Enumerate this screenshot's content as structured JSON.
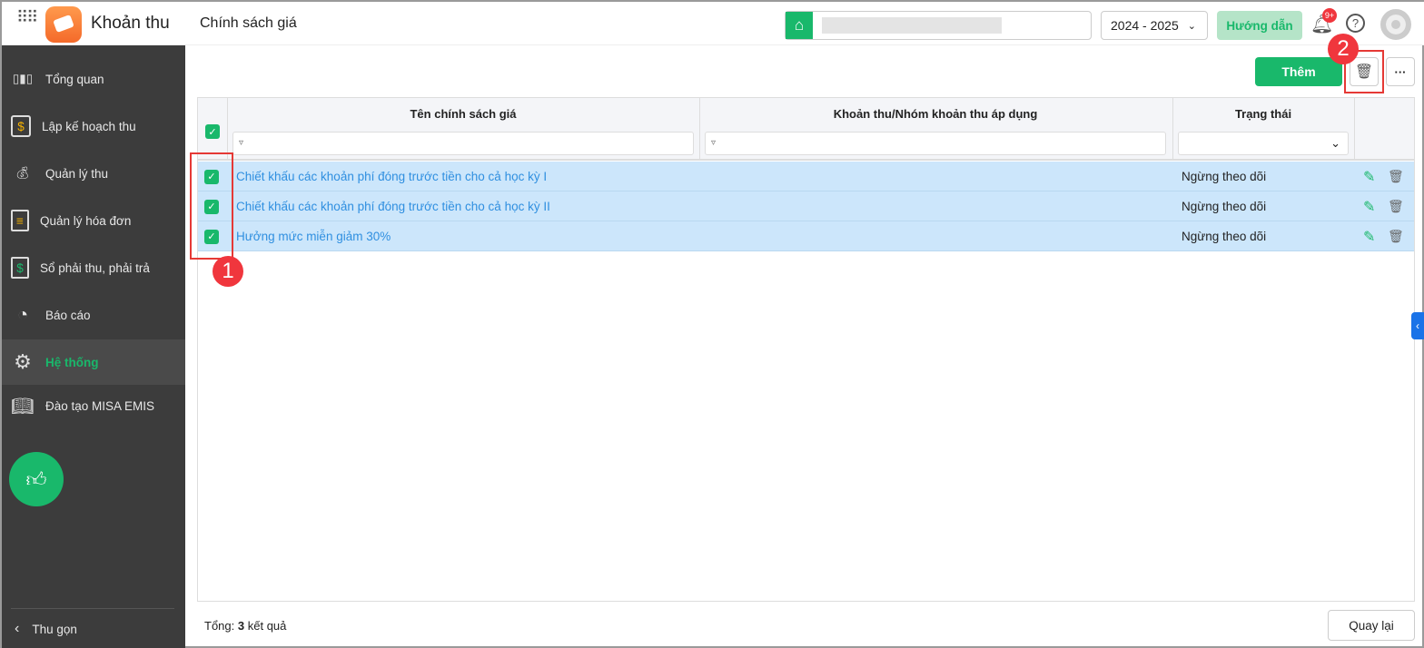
{
  "header": {
    "app_name": "Khoản thu",
    "page_title": "Chính sách giá",
    "year": "2024 - 2025",
    "guide_label": "Hướng dẫn",
    "notif_count": "9+"
  },
  "sidebar": {
    "items": [
      {
        "label": "Tổng quan"
      },
      {
        "label": "Lập kế hoạch thu"
      },
      {
        "label": "Quản lý thu"
      },
      {
        "label": "Quản lý hóa đơn"
      },
      {
        "label": "Sổ phải thu, phải trả"
      },
      {
        "label": "Báo cáo"
      },
      {
        "label": "Hệ thống"
      },
      {
        "label": "Đào tạo MISA EMIS"
      }
    ],
    "collapse_label": "Thu gọn"
  },
  "toolbar": {
    "add_label": "Thêm"
  },
  "table": {
    "columns": [
      "Tên chính sách giá",
      "Khoản thu/Nhóm khoản thu áp dụng",
      "Trạng thái"
    ],
    "rows": [
      {
        "name": "Chiết khấu các khoản phí đóng trước tiền cho cả học kỳ I",
        "applied": "",
        "status": "Ngừng theo dõi"
      },
      {
        "name": "Chiết khấu các khoản phí đóng trước tiền cho cả học kỳ II",
        "applied": "",
        "status": "Ngừng theo dõi"
      },
      {
        "name": "Hưởng mức miễn giảm 30%",
        "applied": "",
        "status": "Ngừng theo dõi"
      }
    ]
  },
  "footer": {
    "total_prefix": "Tổng:",
    "total_count": "3",
    "total_suffix": "kết quả",
    "back_label": "Quay lại"
  },
  "annotations": {
    "one": "1",
    "two": "2"
  }
}
